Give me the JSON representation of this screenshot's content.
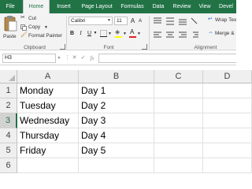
{
  "tabs": [
    "File",
    "Home",
    "Insert",
    "Page Layout",
    "Formulas",
    "Data",
    "Review",
    "View",
    "Devel"
  ],
  "clipboard": {
    "paste": "Paste",
    "cut": "Cut",
    "copy": "Copy",
    "format_painter": "Format Painter",
    "group": "Clipboard"
  },
  "font": {
    "name": "Calibri",
    "size": "11",
    "bold": "B",
    "italic": "I",
    "underline": "U",
    "grow": "A",
    "shrink": "A",
    "highlight": "ab",
    "color": "A",
    "group": "Font"
  },
  "alignment": {
    "wrap": "Wrap Tex",
    "merge": "Merge &",
    "group": "Alignment"
  },
  "formula_bar": {
    "name_box": "H3",
    "cancel": "✕",
    "enter": "✓",
    "fx": "fx",
    "value": ""
  },
  "sheet": {
    "columns": [
      "A",
      "B",
      "C",
      "D"
    ],
    "rows": [
      "1",
      "2",
      "3",
      "4",
      "5",
      "6"
    ],
    "colA": [
      "Monday",
      "Tuesday",
      "Wednesday",
      "Thursday",
      "Friday",
      ""
    ],
    "colB": [
      "Day 1",
      "Day 2",
      "Day 3",
      "Day 4",
      "Day 5",
      ""
    ]
  },
  "colors": {
    "accent": "#217346",
    "font_color_bar": "#e02020",
    "highlight_bar": "#ffff00"
  }
}
